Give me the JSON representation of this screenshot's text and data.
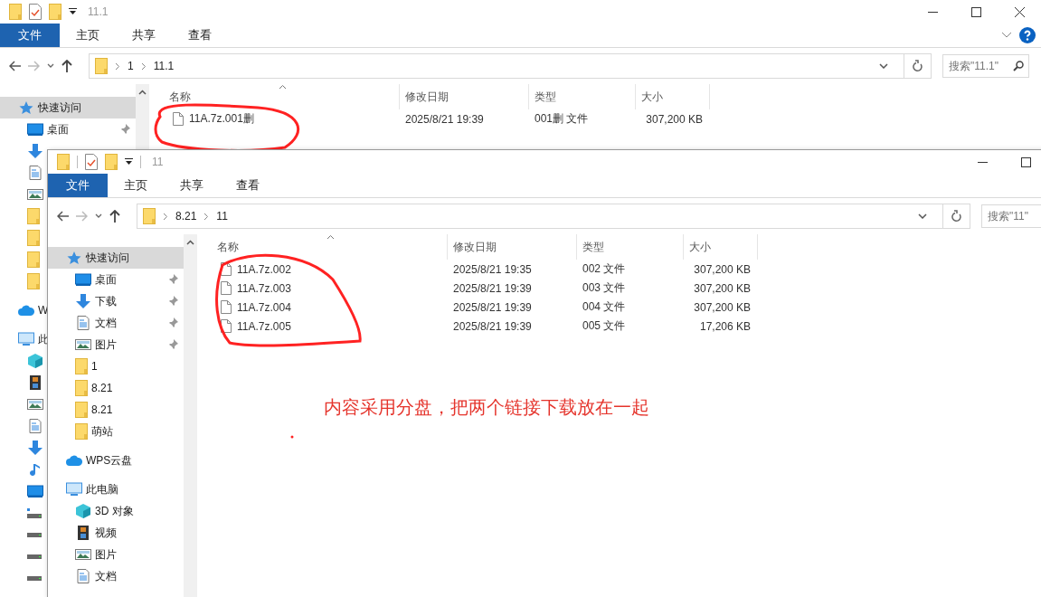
{
  "windows": [
    {
      "title": "11.1",
      "controls": [
        {
          "kind": "minimize"
        },
        {
          "kind": "maximize"
        },
        {
          "kind": "close"
        }
      ],
      "ribbon_tabs": [
        {
          "label": "文件",
          "selected": true
        },
        {
          "label": "主页",
          "selected": false
        },
        {
          "label": "共享",
          "selected": false
        },
        {
          "label": "查看",
          "selected": false
        }
      ],
      "ribbon_extras": true,
      "path": [
        "1",
        "11.1"
      ],
      "search": {
        "placeholder": "搜索\"11.1\"",
        "button": true
      },
      "sidebar": [
        {
          "label": "快速访问",
          "kind": "star",
          "selected": true,
          "children": [
            {
              "label": "桌面",
              "kind": "desktop",
              "pinned": true
            },
            {
              "kind": "download",
              "pinned": false
            },
            {
              "kind": "document",
              "pinned": false
            },
            {
              "kind": "image",
              "pinned": false
            },
            {
              "kind": "folder",
              "pinned": false
            },
            {
              "kind": "folder",
              "pinned": false
            },
            {
              "kind": "folder",
              "pinned": false
            },
            {
              "kind": "folder",
              "pinned": false
            }
          ]
        },
        {
          "label": "W",
          "kind": "cloud",
          "selected": false
        },
        {
          "label": "此",
          "kind": "computer",
          "selected": false,
          "children": [
            {
              "kind": "cube"
            },
            {
              "kind": "film"
            },
            {
              "kind": "image"
            },
            {
              "kind": "document"
            },
            {
              "kind": "download"
            },
            {
              "kind": "music"
            },
            {
              "kind": "desktop"
            },
            {
              "kind": "drive-win"
            },
            {
              "kind": "drive"
            },
            {
              "kind": "drive"
            },
            {
              "kind": "drive"
            }
          ]
        }
      ],
      "columns": [
        "名称",
        "修改日期",
        "类型",
        "大小"
      ],
      "files": [
        {
          "name": "11A.7z.001删",
          "modified": "2025/8/21 19:39",
          "type": "001删 文件",
          "size": "307,200 KB"
        }
      ]
    },
    {
      "title": "11",
      "controls": [
        {
          "kind": "minimize"
        },
        {
          "kind": "maximize"
        }
      ],
      "ribbon_tabs": [
        {
          "label": "文件",
          "selected": true
        },
        {
          "label": "主页",
          "selected": false
        },
        {
          "label": "共享",
          "selected": false
        },
        {
          "label": "查看",
          "selected": false
        }
      ],
      "ribbon_extras": false,
      "path": [
        "8.21",
        "11"
      ],
      "search": {
        "placeholder": "搜索\"11\""
      },
      "sidebar": [
        {
          "label": "快速访问",
          "kind": "star",
          "selected": true,
          "children": [
            {
              "label": "桌面",
              "kind": "desktop",
              "pinned": true
            },
            {
              "label": "下载",
              "kind": "download",
              "pinned": true
            },
            {
              "label": "文档",
              "kind": "document",
              "pinned": true
            },
            {
              "label": "图片",
              "kind": "image",
              "pinned": true
            },
            {
              "label": "1",
              "kind": "folder",
              "pinned": false
            },
            {
              "label": "8.21",
              "kind": "folder",
              "pinned": false
            },
            {
              "label": "8.21",
              "kind": "folder",
              "pinned": false
            },
            {
              "label": "萌站",
              "kind": "folder",
              "pinned": false
            }
          ]
        },
        {
          "label": "WPS云盘",
          "kind": "cloud",
          "selected": false
        },
        {
          "label": "此电脑",
          "kind": "computer",
          "selected": false,
          "children": [
            {
              "label": "3D 对象",
              "kind": "cube"
            },
            {
              "label": "视频",
              "kind": "film"
            },
            {
              "label": "图片",
              "kind": "image"
            },
            {
              "label": "文档",
              "kind": "document"
            }
          ]
        }
      ],
      "columns": [
        "名称",
        "修改日期",
        "类型",
        "大小"
      ],
      "files": [
        {
          "name": "11A.7z.002",
          "modified": "2025/8/21 19:35",
          "type": "002 文件",
          "size": "307,200 KB"
        },
        {
          "name": "11A.7z.003",
          "modified": "2025/8/21 19:39",
          "type": "003 文件",
          "size": "307,200 KB"
        },
        {
          "name": "11A.7z.004",
          "modified": "2025/8/21 19:39",
          "type": "004 文件",
          "size": "307,200 KB"
        },
        {
          "name": "11A.7z.005",
          "modified": "2025/8/21 19:39",
          "type": "005 文件",
          "size": "17,206 KB"
        }
      ],
      "annotation": {
        "text": "内容采用分盘，把两个链接下载放在一起"
      }
    }
  ]
}
